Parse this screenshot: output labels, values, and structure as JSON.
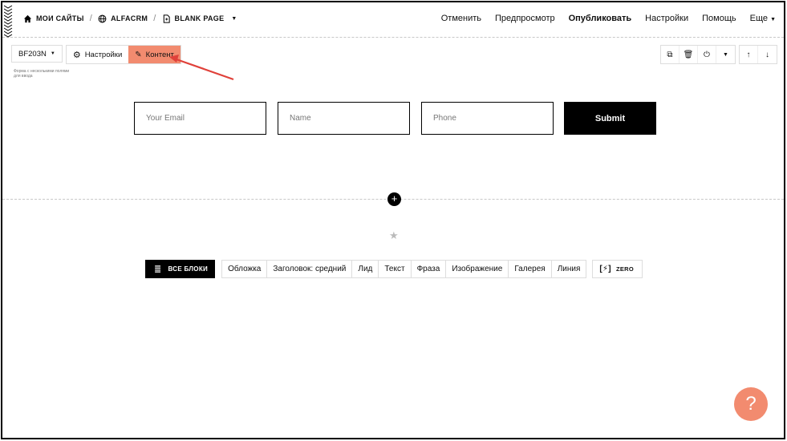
{
  "breadcrumb": {
    "items": [
      {
        "label": "МОИ САЙТЫ",
        "icon": "home-icon"
      },
      {
        "label": "ALFACRM",
        "icon": "globe-icon"
      },
      {
        "label": "BLANK PAGE",
        "icon": "page-icon"
      }
    ],
    "separator": "/"
  },
  "topmenu": {
    "cancel": "Отменить",
    "preview": "Предпросмотр",
    "publish": "Опубликовать",
    "settings": "Настройки",
    "help": "Помощь",
    "more": "Еще"
  },
  "block_toolbar": {
    "block_id": "BF203N",
    "settings_label": "Настройки",
    "content_label": "Контент",
    "description": "Форма с несколькими полями для ввода"
  },
  "form": {
    "email_placeholder": "Your Email",
    "name_placeholder": "Name",
    "phone_placeholder": "Phone",
    "submit_label": "Submit"
  },
  "blocks_bar": {
    "all_blocks_label": "ВСЕ БЛОКИ",
    "categories": [
      "Обложка",
      "Заголовок: средний",
      "Лид",
      "Текст",
      "Фраза",
      "Изображение",
      "Галерея",
      "Линия"
    ],
    "zero_label": "ZERO"
  },
  "plus_symbol": "+",
  "star_symbol": "★",
  "help_symbol": "?",
  "colors": {
    "accent": "#f28b6f",
    "arrow": "#e0413a"
  }
}
